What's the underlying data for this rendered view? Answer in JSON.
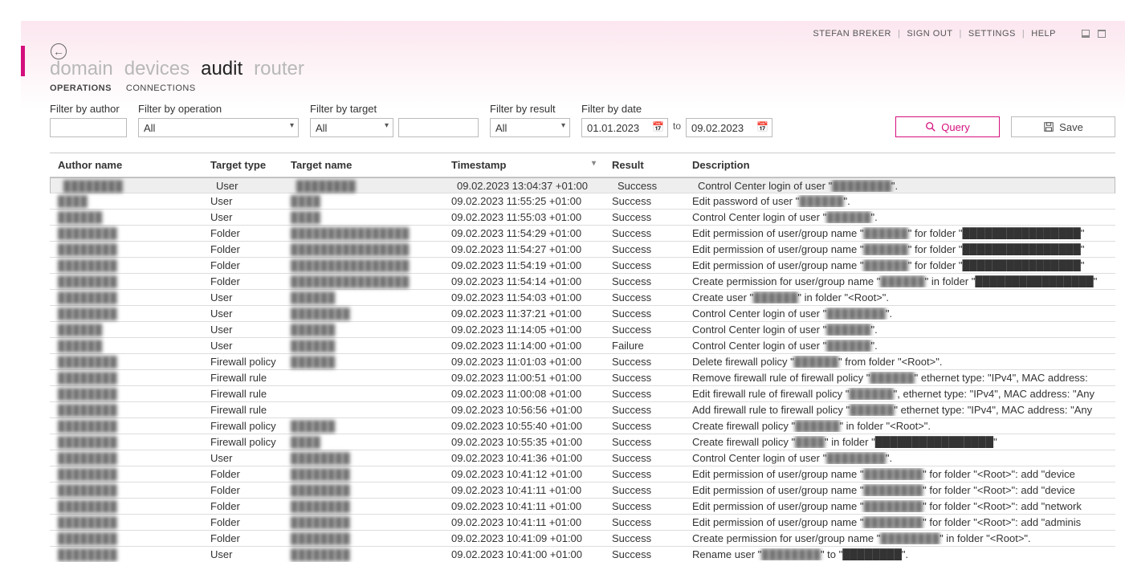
{
  "user": {
    "name": "STEFAN BREKER",
    "signout": "SIGN OUT",
    "settings": "SETTINGS",
    "help": "HELP"
  },
  "nav": {
    "domain": "domain",
    "devices": "devices",
    "audit": "audit",
    "router": "router"
  },
  "subnav": {
    "operations": "OPERATIONS",
    "connections": "CONNECTIONS"
  },
  "filters": {
    "author_label": "Filter by author",
    "author_value": "",
    "operation_label": "Filter by operation",
    "operation_value": "All",
    "target_label": "Filter by target",
    "target_value": "All",
    "targetname_value": "",
    "result_label": "Filter by result",
    "result_value": "All",
    "date_label": "Filter by date",
    "date_from": "01.01.2023",
    "date_to_label": "to",
    "date_to": "09.02.2023"
  },
  "buttons": {
    "query": "Query",
    "save": "Save"
  },
  "columns": {
    "author": "Author name",
    "type": "Target type",
    "target": "Target name",
    "time": "Timestamp",
    "result": "Result",
    "desc": "Description"
  },
  "rows": [
    {
      "author": "████████",
      "type": "User",
      "target": "████████",
      "time": "09.02.2023 13:04:37 +01:00",
      "result": "Success",
      "desc_pre": "Control Center login of user \"",
      "desc_blur": "████████",
      "desc_post": "\"."
    },
    {
      "author": "████",
      "type": "User",
      "target": "████",
      "time": "09.02.2023 11:55:25 +01:00",
      "result": "Success",
      "desc_pre": "Edit password of user \"",
      "desc_blur": "██████",
      "desc_post": "\"."
    },
    {
      "author": "██████",
      "type": "User",
      "target": "████",
      "time": "09.02.2023 11:55:03 +01:00",
      "result": "Success",
      "desc_pre": "Control Center login of user \"",
      "desc_blur": "██████",
      "desc_post": "\"."
    },
    {
      "author": "████████",
      "type": "Folder",
      "target": "████████████████",
      "time": "09.02.2023 11:54:29 +01:00",
      "result": "Success",
      "desc_pre": "Edit permission of user/group name \"",
      "desc_blur": "██████",
      "desc_post": "\" for folder \"████████████████\""
    },
    {
      "author": "████████",
      "type": "Folder",
      "target": "████████████████",
      "time": "09.02.2023 11:54:27 +01:00",
      "result": "Success",
      "desc_pre": "Edit permission of user/group name \"",
      "desc_blur": "██████",
      "desc_post": "\" for folder \"████████████████\""
    },
    {
      "author": "████████",
      "type": "Folder",
      "target": "████████████████",
      "time": "09.02.2023 11:54:19 +01:00",
      "result": "Success",
      "desc_pre": "Edit permission of user/group name \"",
      "desc_blur": "██████",
      "desc_post": "\" for folder \"████████████████\""
    },
    {
      "author": "████████",
      "type": "Folder",
      "target": "████████████████",
      "time": "09.02.2023 11:54:14 +01:00",
      "result": "Success",
      "desc_pre": "Create permission for user/group name \"",
      "desc_blur": "██████",
      "desc_post": "\" in folder \"████████████████\""
    },
    {
      "author": "████████",
      "type": "User",
      "target": "██████",
      "time": "09.02.2023 11:54:03 +01:00",
      "result": "Success",
      "desc_pre": "Create user \"",
      "desc_blur": "██████",
      "desc_post": "\" in folder \"<Root>\"."
    },
    {
      "author": "████████",
      "type": "User",
      "target": "████████",
      "time": "09.02.2023 11:37:21 +01:00",
      "result": "Success",
      "desc_pre": "Control Center login of user \"",
      "desc_blur": "████████",
      "desc_post": "\"."
    },
    {
      "author": "██████",
      "type": "User",
      "target": "██████",
      "time": "09.02.2023 11:14:05 +01:00",
      "result": "Success",
      "desc_pre": "Control Center login of user \"",
      "desc_blur": "██████",
      "desc_post": "\"."
    },
    {
      "author": "██████",
      "type": "User",
      "target": "██████",
      "time": "09.02.2023 11:14:00 +01:00",
      "result": "Failure",
      "desc_pre": "Control Center login of user \"",
      "desc_blur": "██████",
      "desc_post": "\"."
    },
    {
      "author": "████████",
      "type": "Firewall policy",
      "target": "██████",
      "time": "09.02.2023 11:01:03 +01:00",
      "result": "Success",
      "desc_pre": "Delete firewall policy \"",
      "desc_blur": "██████",
      "desc_post": "\" from folder \"<Root>\"."
    },
    {
      "author": "████████",
      "type": "Firewall rule",
      "target": "",
      "time": "09.02.2023 11:00:51 +01:00",
      "result": "Success",
      "desc_pre": "Remove firewall rule of firewall policy \"",
      "desc_blur": "██████",
      "desc_post": "\" ethernet type: \"IPv4\", MAC address:"
    },
    {
      "author": "████████",
      "type": "Firewall rule",
      "target": "",
      "time": "09.02.2023 11:00:08 +01:00",
      "result": "Success",
      "desc_pre": "Edit firewall rule of firewall policy \"",
      "desc_blur": "██████",
      "desc_post": "\", ethernet type: \"IPv4\", MAC address: \"Any"
    },
    {
      "author": "████████",
      "type": "Firewall rule",
      "target": "",
      "time": "09.02.2023 10:56:56 +01:00",
      "result": "Success",
      "desc_pre": "Add firewall rule to firewall policy \"",
      "desc_blur": "██████",
      "desc_post": "\" ethernet type: \"IPv4\", MAC address: \"Any"
    },
    {
      "author": "████████",
      "type": "Firewall policy",
      "target": "██████",
      "time": "09.02.2023 10:55:40 +01:00",
      "result": "Success",
      "desc_pre": "Create firewall policy \"",
      "desc_blur": "██████",
      "desc_post": "\" in folder \"<Root>\"."
    },
    {
      "author": "████████",
      "type": "Firewall policy",
      "target": "████",
      "time": "09.02.2023 10:55:35 +01:00",
      "result": "Success",
      "desc_pre": "Create firewall policy \"",
      "desc_blur": "████",
      "desc_post": "\" in folder \"████████████████\""
    },
    {
      "author": "████████",
      "type": "User",
      "target": "████████",
      "time": "09.02.2023 10:41:36 +01:00",
      "result": "Success",
      "desc_pre": "Control Center login of user \"",
      "desc_blur": "████████",
      "desc_post": "\"."
    },
    {
      "author": "████████",
      "type": "Folder",
      "target": "████████",
      "time": "09.02.2023 10:41:12 +01:00",
      "result": "Success",
      "desc_pre": "Edit permission of user/group name \"",
      "desc_blur": "████████",
      "desc_post": "\" for folder \"<Root>\": add \"device"
    },
    {
      "author": "████████",
      "type": "Folder",
      "target": "████████",
      "time": "09.02.2023 10:41:11 +01:00",
      "result": "Success",
      "desc_pre": "Edit permission of user/group name \"",
      "desc_blur": "████████",
      "desc_post": "\" for folder \"<Root>\": add \"device"
    },
    {
      "author": "████████",
      "type": "Folder",
      "target": "████████",
      "time": "09.02.2023 10:41:11 +01:00",
      "result": "Success",
      "desc_pre": "Edit permission of user/group name \"",
      "desc_blur": "████████",
      "desc_post": "\" for folder \"<Root>\": add \"network"
    },
    {
      "author": "████████",
      "type": "Folder",
      "target": "████████",
      "time": "09.02.2023 10:41:11 +01:00",
      "result": "Success",
      "desc_pre": "Edit permission of user/group name \"",
      "desc_blur": "████████",
      "desc_post": "\" for folder \"<Root>\": add \"adminis"
    },
    {
      "author": "████████",
      "type": "Folder",
      "target": "████████",
      "time": "09.02.2023 10:41:09 +01:00",
      "result": "Success",
      "desc_pre": "Create permission for user/group name \"",
      "desc_blur": "████████",
      "desc_post": "\" in folder \"<Root>\"."
    },
    {
      "author": "████████",
      "type": "User",
      "target": "████████",
      "time": "09.02.2023 10:41:00 +01:00",
      "result": "Success",
      "desc_pre": "Rename user \"",
      "desc_blur": "████████",
      "desc_post": "\" to \"████████\"."
    }
  ]
}
